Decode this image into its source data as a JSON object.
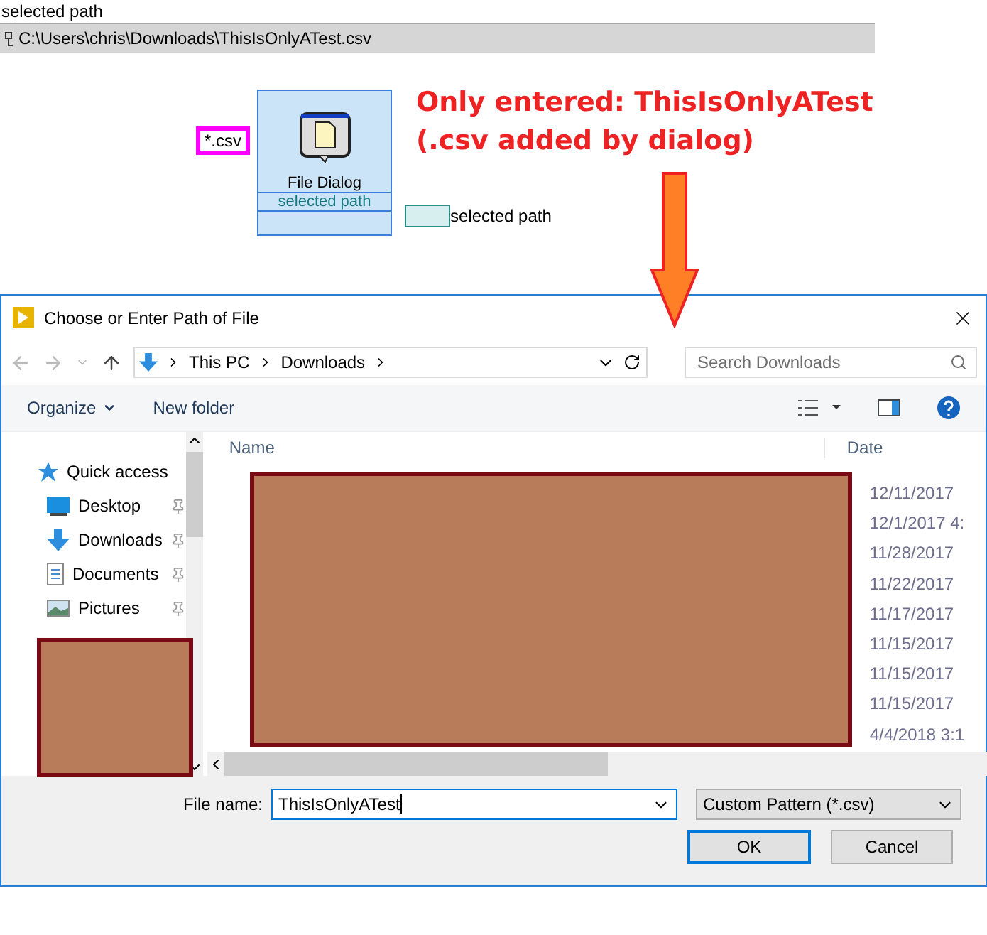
{
  "indicator": {
    "label": "selected path",
    "value": "C:\\Users\\chris\\Downloads\\ThisIsOnlyATest.csv"
  },
  "diagram": {
    "constant": "*.csv",
    "node_title": "File Dialog",
    "node_output": "selected path",
    "indicator_label": "selected path"
  },
  "annotation": [
    "Only entered: ThisIsOnlyATest",
    "(.csv added by dialog)"
  ],
  "dialog": {
    "title": "Choose or Enter Path of File",
    "breadcrumb": [
      "This PC",
      "Downloads"
    ],
    "search": {
      "placeholder": "Search Downloads"
    },
    "toolbar": [
      {
        "label": "Organize",
        "menu": true
      },
      {
        "label": "New folder",
        "menu": false
      }
    ],
    "nav_items": [
      {
        "label": "Quick access",
        "kind": "star"
      },
      {
        "label": "Desktop",
        "kind": "desktop"
      },
      {
        "label": "Downloads",
        "kind": "download"
      },
      {
        "label": "Documents",
        "kind": "document"
      },
      {
        "label": "Pictures",
        "kind": "picture"
      }
    ],
    "columns": [
      "Name",
      "Date"
    ],
    "dates": [
      "12/11/2017",
      "12/1/2017 4:",
      "11/28/2017",
      "11/22/2017",
      "11/17/2017",
      "11/15/2017",
      "11/15/2017",
      "11/15/2017",
      "4/4/2018 3:1"
    ],
    "file_name": {
      "label": "File name:",
      "value": "ThisIsOnlyATest"
    },
    "filter": "Custom Pattern (*.csv)",
    "buttons": [
      {
        "label": "OK",
        "default": true
      },
      {
        "label": "Cancel",
        "default": false
      }
    ]
  }
}
